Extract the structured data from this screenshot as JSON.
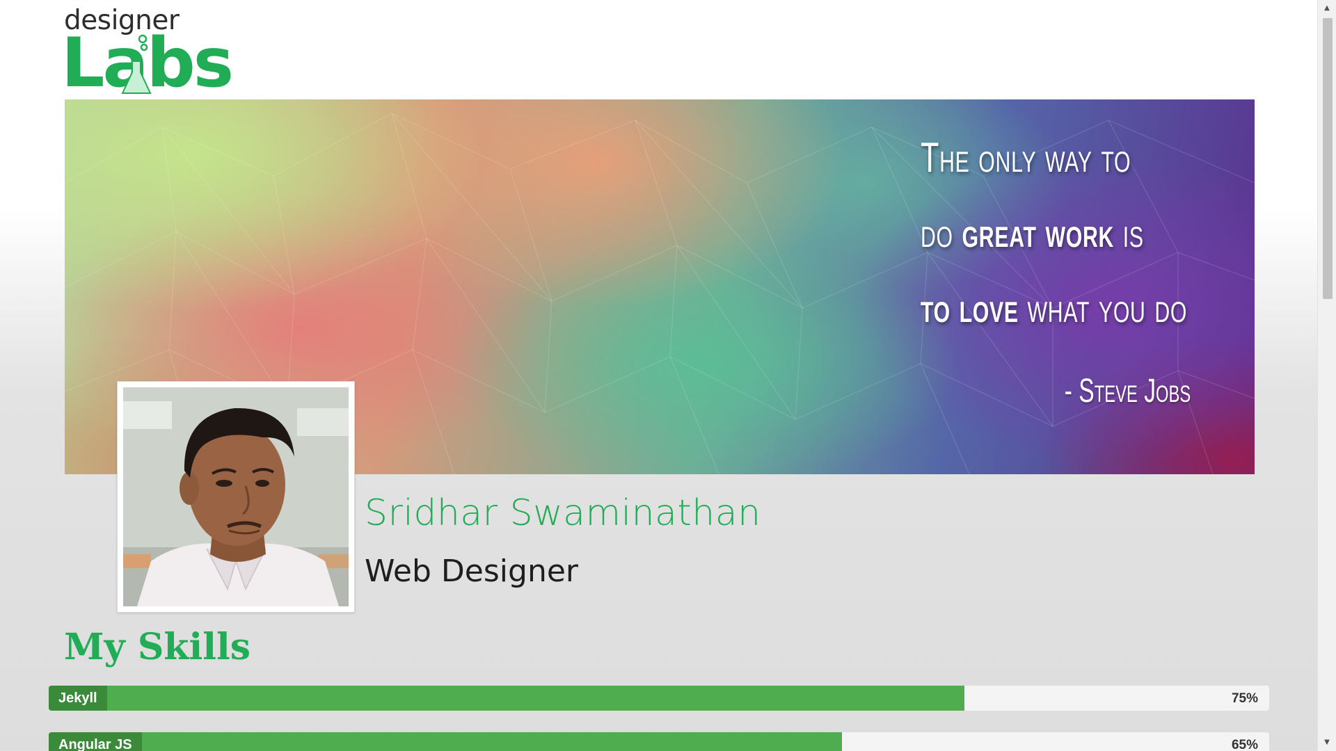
{
  "logo": {
    "line1": "designer",
    "line2": "Labs"
  },
  "banner": {
    "quote_lines": [
      {
        "parts": [
          {
            "text": "The only way to",
            "bold": false
          }
        ]
      },
      {
        "parts": [
          {
            "text": "do ",
            "bold": false
          },
          {
            "text": "great work",
            "bold": true
          },
          {
            "text": " is",
            "bold": false
          }
        ]
      },
      {
        "parts": [
          {
            "text": "to love",
            "bold": true
          },
          {
            "text": " what you do",
            "bold": false
          }
        ]
      }
    ],
    "author": "- Steve Jobs"
  },
  "profile": {
    "name": "Sridhar Swaminathan",
    "role": "Web Designer"
  },
  "skills": {
    "title": "My Skills",
    "items": [
      {
        "label": "Jekyll",
        "percent_text": "75%",
        "percent": 75
      },
      {
        "label": "Angular JS",
        "percent_text": "65%",
        "percent": 65
      }
    ]
  },
  "scrollbar": {
    "up_arrow": "▲",
    "down_arrow": "▼"
  },
  "colors": {
    "brand_green": "#21ad55",
    "bar_fill": "#4fad4f",
    "bar_label_bg": "#3a8a3a",
    "bar_track": "#f4f4f4"
  }
}
